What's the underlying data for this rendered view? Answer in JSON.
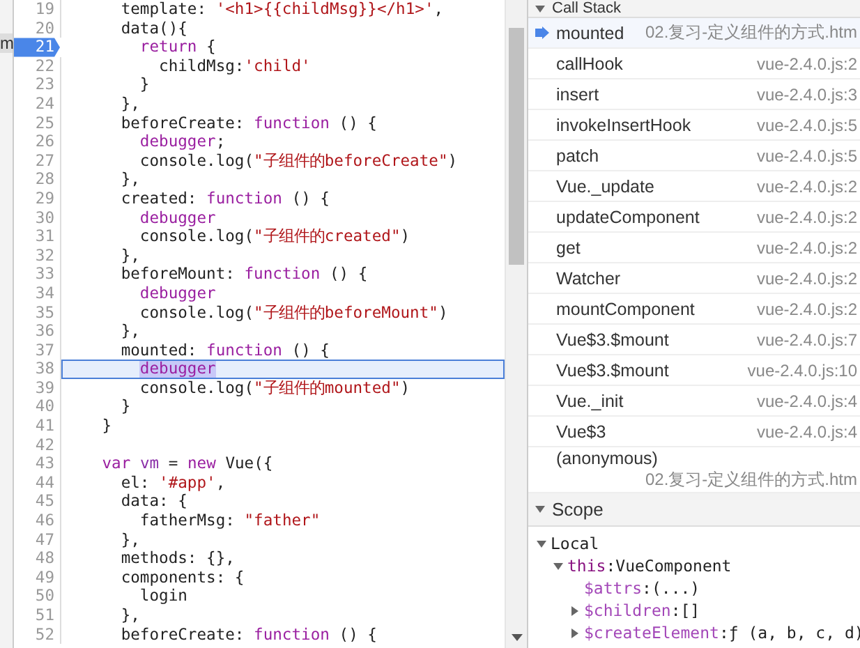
{
  "side_tab": {
    "label": "m"
  },
  "editor": {
    "lines": [
      {
        "number": "19",
        "breakpoint": false,
        "current": false,
        "segments": [
          {
            "text": "      template: ",
            "kind": "plain"
          },
          {
            "text": "'<h1>{{childMsg}}</h1>'",
            "kind": "string"
          },
          {
            "text": ",",
            "kind": "plain"
          }
        ]
      },
      {
        "number": "20",
        "breakpoint": false,
        "current": false,
        "segments": [
          {
            "text": "      data(){",
            "kind": "plain"
          }
        ]
      },
      {
        "number": "21",
        "breakpoint": true,
        "current": false,
        "segments": [
          {
            "text": "        return",
            "kind": "keyword"
          },
          {
            "text": " {",
            "kind": "plain"
          }
        ]
      },
      {
        "number": "22",
        "breakpoint": false,
        "current": false,
        "segments": [
          {
            "text": "          childMsg:",
            "kind": "plain"
          },
          {
            "text": "'child'",
            "kind": "string"
          }
        ]
      },
      {
        "number": "23",
        "breakpoint": false,
        "current": false,
        "segments": [
          {
            "text": "        }",
            "kind": "plain"
          }
        ]
      },
      {
        "number": "24",
        "breakpoint": false,
        "current": false,
        "segments": [
          {
            "text": "      },",
            "kind": "plain"
          }
        ]
      },
      {
        "number": "25",
        "breakpoint": false,
        "current": false,
        "segments": [
          {
            "text": "      beforeCreate: ",
            "kind": "plain"
          },
          {
            "text": "function",
            "kind": "keyword"
          },
          {
            "text": " () {",
            "kind": "plain"
          }
        ]
      },
      {
        "number": "26",
        "breakpoint": false,
        "current": false,
        "segments": [
          {
            "text": "        debugger",
            "kind": "keyword"
          },
          {
            "text": ";",
            "kind": "plain"
          }
        ]
      },
      {
        "number": "27",
        "breakpoint": false,
        "current": false,
        "segments": [
          {
            "text": "        console.log(",
            "kind": "plain"
          },
          {
            "text": "\"子组件的beforeCreate\"",
            "kind": "string"
          },
          {
            "text": ")",
            "kind": "plain"
          }
        ]
      },
      {
        "number": "28",
        "breakpoint": false,
        "current": false,
        "segments": [
          {
            "text": "      },",
            "kind": "plain"
          }
        ]
      },
      {
        "number": "29",
        "breakpoint": false,
        "current": false,
        "segments": [
          {
            "text": "      created: ",
            "kind": "plain"
          },
          {
            "text": "function",
            "kind": "keyword"
          },
          {
            "text": " () {",
            "kind": "plain"
          }
        ]
      },
      {
        "number": "30",
        "breakpoint": false,
        "current": false,
        "segments": [
          {
            "text": "        debugger",
            "kind": "keyword"
          }
        ]
      },
      {
        "number": "31",
        "breakpoint": false,
        "current": false,
        "segments": [
          {
            "text": "        console.log(",
            "kind": "plain"
          },
          {
            "text": "\"子组件的created\"",
            "kind": "string"
          },
          {
            "text": ")",
            "kind": "plain"
          }
        ]
      },
      {
        "number": "32",
        "breakpoint": false,
        "current": false,
        "segments": [
          {
            "text": "      },",
            "kind": "plain"
          }
        ]
      },
      {
        "number": "33",
        "breakpoint": false,
        "current": false,
        "segments": [
          {
            "text": "      beforeMount: ",
            "kind": "plain"
          },
          {
            "text": "function",
            "kind": "keyword"
          },
          {
            "text": " () {",
            "kind": "plain"
          }
        ]
      },
      {
        "number": "34",
        "breakpoint": false,
        "current": false,
        "segments": [
          {
            "text": "        debugger",
            "kind": "keyword"
          }
        ]
      },
      {
        "number": "35",
        "breakpoint": false,
        "current": false,
        "segments": [
          {
            "text": "        console.log(",
            "kind": "plain"
          },
          {
            "text": "\"子组件的beforeMount\"",
            "kind": "string"
          },
          {
            "text": ")",
            "kind": "plain"
          }
        ]
      },
      {
        "number": "36",
        "breakpoint": false,
        "current": false,
        "segments": [
          {
            "text": "      },",
            "kind": "plain"
          }
        ]
      },
      {
        "number": "37",
        "breakpoint": false,
        "current": false,
        "segments": [
          {
            "text": "      mounted: ",
            "kind": "plain"
          },
          {
            "text": "function",
            "kind": "keyword"
          },
          {
            "text": " () {",
            "kind": "plain"
          }
        ]
      },
      {
        "number": "38",
        "breakpoint": false,
        "current": true,
        "segments": [
          {
            "text": "        debugger",
            "kind": "keyword"
          }
        ]
      },
      {
        "number": "39",
        "breakpoint": false,
        "current": false,
        "segments": [
          {
            "text": "        console.log(",
            "kind": "plain"
          },
          {
            "text": "\"子组件的mounted\"",
            "kind": "string"
          },
          {
            "text": ")",
            "kind": "plain"
          }
        ]
      },
      {
        "number": "40",
        "breakpoint": false,
        "current": false,
        "segments": [
          {
            "text": "      }",
            "kind": "plain"
          }
        ]
      },
      {
        "number": "41",
        "breakpoint": false,
        "current": false,
        "segments": [
          {
            "text": "    }",
            "kind": "plain"
          }
        ]
      },
      {
        "number": "42",
        "breakpoint": false,
        "current": false
      },
      {
        "number": "43",
        "breakpoint": false,
        "current": false,
        "segments": [
          {
            "text": "    var",
            "kind": "keyword"
          },
          {
            "text": " vm",
            "kind": "definition"
          },
          {
            "text": " = ",
            "kind": "plain"
          },
          {
            "text": "new",
            "kind": "keyword"
          },
          {
            "text": " Vue({",
            "kind": "plain"
          }
        ]
      },
      {
        "number": "44",
        "breakpoint": false,
        "current": false,
        "segments": [
          {
            "text": "      el: ",
            "kind": "plain"
          },
          {
            "text": "'#app'",
            "kind": "string"
          },
          {
            "text": ",",
            "kind": "plain"
          }
        ]
      },
      {
        "number": "45",
        "breakpoint": false,
        "current": false,
        "segments": [
          {
            "text": "      data: {",
            "kind": "plain"
          }
        ]
      },
      {
        "number": "46",
        "breakpoint": false,
        "current": false,
        "segments": [
          {
            "text": "        fatherMsg: ",
            "kind": "plain"
          },
          {
            "text": "\"father\"",
            "kind": "string"
          }
        ]
      },
      {
        "number": "47",
        "breakpoint": false,
        "current": false,
        "segments": [
          {
            "text": "      },",
            "kind": "plain"
          }
        ]
      },
      {
        "number": "48",
        "breakpoint": false,
        "current": false,
        "segments": [
          {
            "text": "      methods: {},",
            "kind": "plain"
          }
        ]
      },
      {
        "number": "49",
        "breakpoint": false,
        "current": false,
        "segments": [
          {
            "text": "      components: {",
            "kind": "plain"
          }
        ]
      },
      {
        "number": "50",
        "breakpoint": false,
        "current": false,
        "segments": [
          {
            "text": "        login",
            "kind": "plain"
          }
        ]
      },
      {
        "number": "51",
        "breakpoint": false,
        "current": false,
        "segments": [
          {
            "text": "      },",
            "kind": "plain"
          }
        ]
      },
      {
        "number": "52",
        "breakpoint": false,
        "current": false,
        "segments": [
          {
            "text": "      beforeCreate: ",
            "kind": "plain"
          },
          {
            "text": "function",
            "kind": "keyword"
          },
          {
            "text": " () {",
            "kind": "plain"
          }
        ]
      }
    ]
  },
  "call_stack": {
    "title": "Call Stack",
    "expanded": true,
    "frames": [
      {
        "function": "mounted",
        "location": "02.复习-定义组件的方式.htm",
        "selected": true,
        "wrapped": false
      },
      {
        "function": "callHook",
        "location": "vue-2.4.0.js:2",
        "selected": false,
        "wrapped": false
      },
      {
        "function": "insert",
        "location": "vue-2.4.0.js:3",
        "selected": false,
        "wrapped": false
      },
      {
        "function": "invokeInsertHook",
        "location": "vue-2.4.0.js:5",
        "selected": false,
        "wrapped": false
      },
      {
        "function": "patch",
        "location": "vue-2.4.0.js:5",
        "selected": false,
        "wrapped": false
      },
      {
        "function": "Vue._update",
        "location": "vue-2.4.0.js:2",
        "selected": false,
        "wrapped": false
      },
      {
        "function": "updateComponent",
        "location": "vue-2.4.0.js:2",
        "selected": false,
        "wrapped": false
      },
      {
        "function": "get",
        "location": "vue-2.4.0.js:2",
        "selected": false,
        "wrapped": false
      },
      {
        "function": "Watcher",
        "location": "vue-2.4.0.js:2",
        "selected": false,
        "wrapped": false
      },
      {
        "function": "mountComponent",
        "location": "vue-2.4.0.js:2",
        "selected": false,
        "wrapped": false
      },
      {
        "function": "Vue$3.$mount",
        "location": "vue-2.4.0.js:7",
        "selected": false,
        "wrapped": false
      },
      {
        "function": "Vue$3.$mount",
        "location": "vue-2.4.0.js:10",
        "selected": false,
        "wrapped": false
      },
      {
        "function": "Vue._init",
        "location": "vue-2.4.0.js:4",
        "selected": false,
        "wrapped": false
      },
      {
        "function": "Vue$3",
        "location": "vue-2.4.0.js:4",
        "selected": false,
        "wrapped": false
      },
      {
        "function": "(anonymous)",
        "location": "02.复习-定义组件的方式.htm",
        "selected": false,
        "wrapped": true
      }
    ]
  },
  "scope": {
    "title": "Scope",
    "expanded": true,
    "tree": [
      {
        "name": "Local",
        "collapsible": true,
        "expanded": true,
        "children": [
          {
            "name": "this",
            "separator": ":",
            "value": "VueComponent",
            "collapsible": true,
            "expanded": true,
            "children": [
              {
                "name": "$attrs",
                "separator": ":",
                "value": "(...)",
                "collapsible": false,
                "expanded": false
              },
              {
                "name": "$children",
                "separator": ":",
                "value": "[]",
                "collapsible": true,
                "expanded": false
              },
              {
                "name": "$createElement",
                "separator": ":",
                "value": "ƒ (a, b, c, d)",
                "collapsible": true,
                "expanded": false
              }
            ]
          }
        ]
      }
    ]
  }
}
